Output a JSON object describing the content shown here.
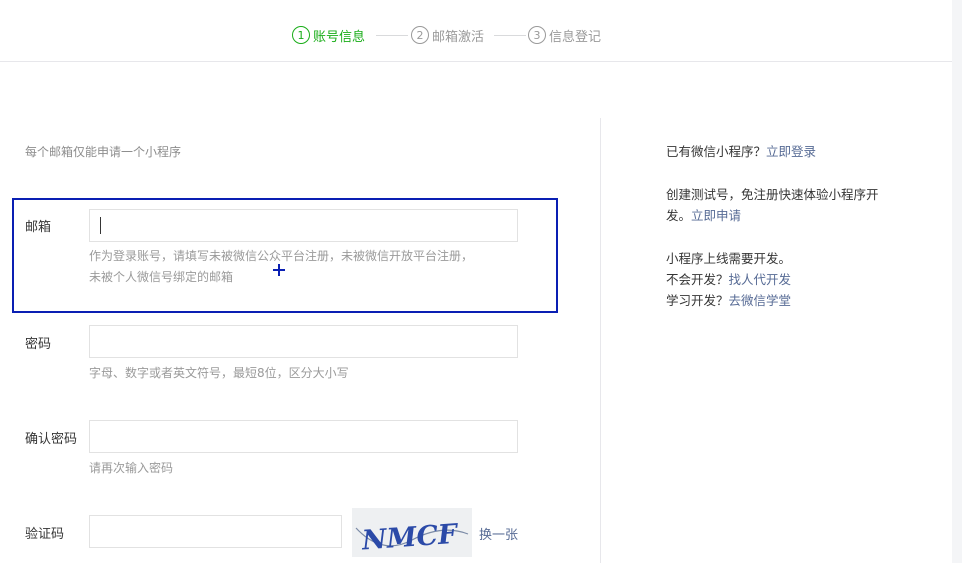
{
  "steps": [
    {
      "num": "1",
      "label": "账号信息",
      "active": true
    },
    {
      "num": "2",
      "label": "邮箱激活",
      "active": false
    },
    {
      "num": "3",
      "label": "信息登记",
      "active": false
    }
  ],
  "form": {
    "tip": "每个邮箱仅能申请一个小程序",
    "email": {
      "label": "邮箱",
      "value": "",
      "help_line1": "作为登录账号，请填写未被微信公众平台注册，未被微信开放平台注册，",
      "help_line2": "未被个人微信号绑定的邮箱"
    },
    "password": {
      "label": "密码",
      "value": "",
      "help": "字母、数字或者英文符号，最短8位，区分大小写"
    },
    "confirm": {
      "label": "确认密码",
      "value": "",
      "help": "请再次输入密码"
    },
    "captcha": {
      "label": "验证码",
      "value": "",
      "image_text": "NMCF",
      "refresh": "换一张"
    }
  },
  "side": {
    "login_q": "已有微信小程序？",
    "login_link": "立即登录",
    "test_text": "创建测试号，免注册快速体验小程序开发。",
    "test_line1": "创建测试号，免注册快速体验小程序开",
    "test_line2": "发。",
    "test_link": "立即申请",
    "dev_text": "小程序上线需要开发。",
    "no_dev_q": "不会开发？",
    "no_dev_link": "找人代开发",
    "learn_q": "学习开发？",
    "learn_link": "去微信学堂"
  },
  "colors": {
    "accent": "#1aad19",
    "link": "#576b95",
    "highlight": "#0a1fb3"
  }
}
